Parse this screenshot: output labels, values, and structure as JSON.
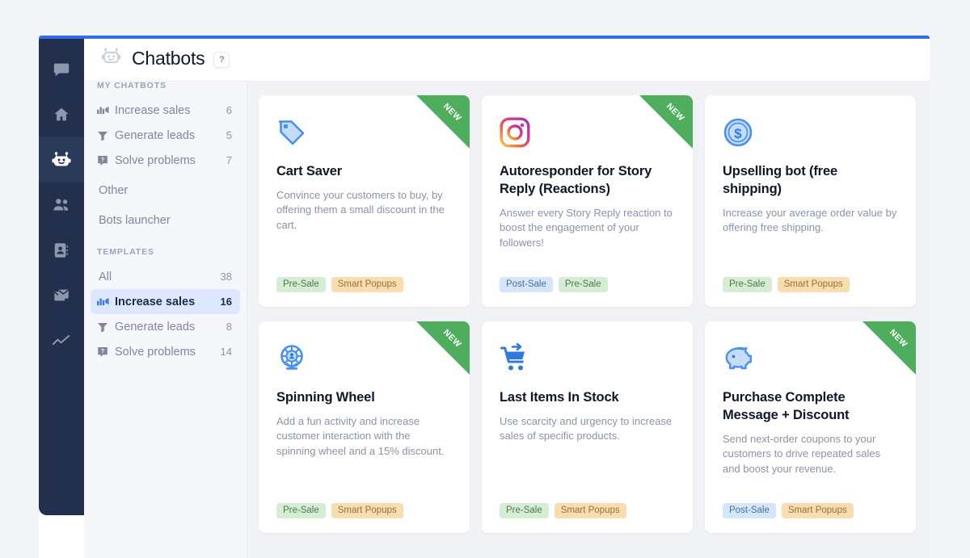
{
  "window": {
    "accent_color": "#2f6fed"
  },
  "icon_rail": {
    "items": [
      {
        "name": "chat-icon",
        "label": "Chats"
      },
      {
        "name": "home-icon",
        "label": "Home"
      },
      {
        "name": "chatbot-icon",
        "label": "Chatbots",
        "active": true
      },
      {
        "name": "team-icon",
        "label": "Team"
      },
      {
        "name": "contacts-icon",
        "label": "Contacts"
      },
      {
        "name": "inbox-icon",
        "label": "Inbox"
      },
      {
        "name": "analytics-icon",
        "label": "Analytics"
      }
    ]
  },
  "topbar": {
    "icon": "chatbot-icon",
    "title": "Chatbots",
    "help_badge": "?"
  },
  "sidebar": {
    "section_my_chatbots": "MY CHATBOTS",
    "my_chatbots": [
      {
        "icon": "increase-sales-icon",
        "label": "Increase sales",
        "count": "6"
      },
      {
        "icon": "generate-leads-icon",
        "label": "Generate leads",
        "count": "5"
      },
      {
        "icon": "solve-problems-icon",
        "label": "Solve problems",
        "count": "7"
      },
      {
        "icon": "",
        "label": "Other",
        "count": ""
      },
      {
        "icon": "",
        "label": "Bots launcher",
        "count": ""
      }
    ],
    "section_templates": "TEMPLATES",
    "templates": [
      {
        "icon": "",
        "label": "All",
        "count": "38",
        "active": false
      },
      {
        "icon": "increase-sales-icon",
        "label": "Increase sales",
        "count": "16",
        "active": true
      },
      {
        "icon": "generate-leads-icon",
        "label": "Generate leads",
        "count": "8",
        "active": false
      },
      {
        "icon": "solve-problems-icon",
        "label": "Solve problems",
        "count": "14",
        "active": false
      }
    ]
  },
  "cards": [
    {
      "icon": "tag-icon",
      "title": "Cart Saver",
      "description": "Convince your customers to buy, by offering them a small discount in the cart.",
      "badge": "NEW",
      "tags": [
        {
          "label": "Pre-Sale",
          "color": "green"
        },
        {
          "label": "Smart Popups",
          "color": "orange"
        }
      ]
    },
    {
      "icon": "instagram-icon",
      "title": "Autoresponder for Story Reply (Reactions)",
      "description": "Answer every Story Reply reaction to boost the engagement of your followers!",
      "badge": "NEW",
      "tags": [
        {
          "label": "Post-Sale",
          "color": "blue"
        },
        {
          "label": "Pre-Sale",
          "color": "green"
        }
      ]
    },
    {
      "icon": "dollar-coin-icon",
      "title": "Upselling bot (free shipping)",
      "description": "Increase your average order value by offering free shipping.",
      "badge": "",
      "tags": [
        {
          "label": "Pre-Sale",
          "color": "green"
        },
        {
          "label": "Smart Popups",
          "color": "orange"
        }
      ]
    },
    {
      "icon": "ferris-wheel-icon",
      "title": "Spinning Wheel",
      "description": "Add a fun activity and increase customer interaction with the spinning wheel and a 15% discount.",
      "badge": "NEW",
      "tags": [
        {
          "label": "Pre-Sale",
          "color": "green"
        },
        {
          "label": "Smart Popups",
          "color": "orange"
        }
      ]
    },
    {
      "icon": "cart-arrow-icon",
      "title": "Last Items In Stock",
      "description": "Use scarcity and urgency to increase sales of specific products.",
      "badge": "",
      "tags": [
        {
          "label": "Pre-Sale",
          "color": "green"
        },
        {
          "label": "Smart Popups",
          "color": "orange"
        }
      ]
    },
    {
      "icon": "piggy-bank-icon",
      "title": "Purchase Complete Message + Discount",
      "description": "Send next-order coupons to your customers to drive repeated sales and boost your revenue.",
      "badge": "NEW",
      "tags": [
        {
          "label": "Post-Sale",
          "color": "blue"
        },
        {
          "label": "Smart Popups",
          "color": "orange"
        }
      ]
    }
  ]
}
